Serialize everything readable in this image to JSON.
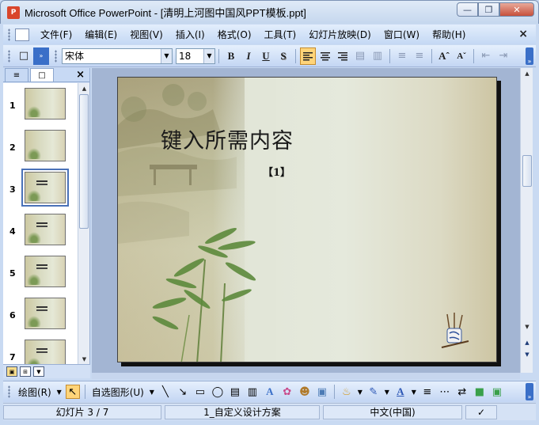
{
  "window": {
    "title": "Microsoft Office PowerPoint - [清明上河图中国风PPT模板.ppt]",
    "app_icon": "P"
  },
  "menu": {
    "items": [
      "文件(F)",
      "编辑(E)",
      "视图(V)",
      "插入(I)",
      "格式(O)",
      "工具(T)",
      "幻灯片放映(D)",
      "窗口(W)",
      "帮助(H)"
    ],
    "close": "×"
  },
  "format_toolbar": {
    "font_name": "宋体",
    "font_size": "18",
    "bold": "B",
    "italic": "I",
    "underline": "U",
    "shadow": "S",
    "align_left_active": true
  },
  "outline_pane": {
    "close": "×",
    "slides": [
      {
        "number": "1"
      },
      {
        "number": "2"
      },
      {
        "number": "3",
        "selected": true
      },
      {
        "number": "4"
      },
      {
        "number": "5"
      },
      {
        "number": "6"
      },
      {
        "number": "7"
      }
    ]
  },
  "slide": {
    "title": "键入所需内容",
    "subtitle": "【1】"
  },
  "drawing_toolbar": {
    "draw_label": "绘图(R)",
    "autoshapes_label": "自选图形(U)"
  },
  "status": {
    "slide_counter": "幻灯片 3 / 7",
    "design": "1_自定义设计方案",
    "language": "中文(中国)"
  },
  "colors": {
    "accent": "#3a6fc8",
    "active_button": "#ffd479"
  }
}
